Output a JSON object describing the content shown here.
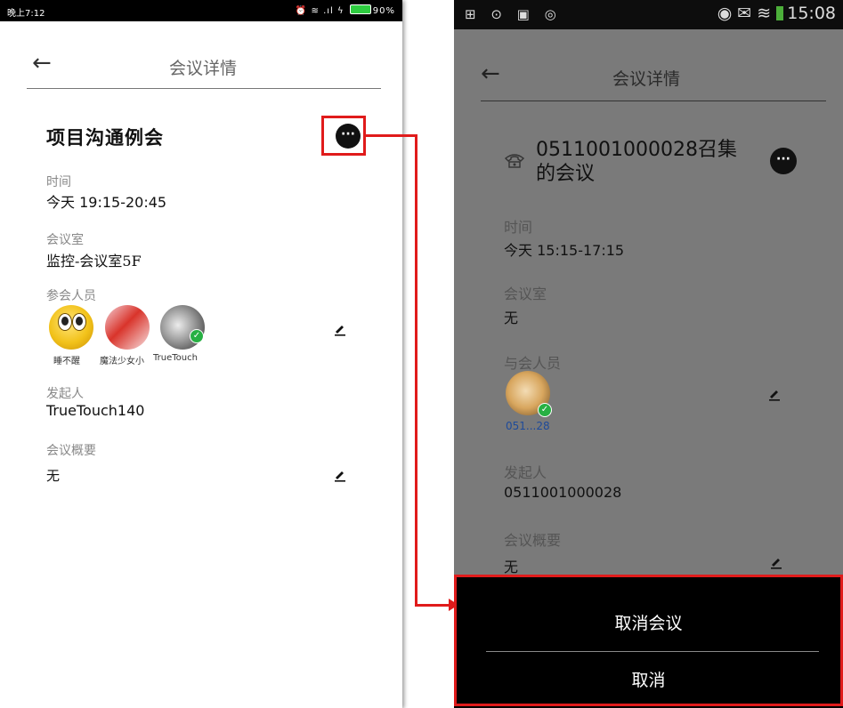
{
  "left": {
    "status_time": "晚上7:12",
    "status_icons": "⏰ ≋ .ıl ϟ",
    "battery": "90%",
    "title": "会议详情",
    "meeting_title": "项目沟通例会",
    "more_glyph": "···",
    "time_label": "时间",
    "time_value": "今天 19:15-20:45",
    "room_label": "会议室",
    "room_value": "监控-会议室5F",
    "attendees_label": "参会人员",
    "attendees": [
      "睡不醒",
      "魔法少女小",
      "TrueTouch"
    ],
    "organizer_label": "发起人",
    "organizer_value": "TrueTouch140",
    "summary_label": "会议概要",
    "summary_value": "无"
  },
  "right": {
    "status_left_icons": "⊞ ⊙ ▣ ◎",
    "status_right_icons": "◉ ✉ ≋",
    "status_time": "15:08",
    "title": "会议详情",
    "meeting_title": "0511001000028召集的会议",
    "more_glyph": "···",
    "time_label": "时间",
    "time_value": "今天 15:15-17:15",
    "room_label": "会议室",
    "room_value": "无",
    "attendees_label": "与会人员",
    "attendees": [
      "051...28"
    ],
    "organizer_label": "发起人",
    "organizer_value": "0511001000028",
    "summary_label": "会议概要",
    "summary_value": "无",
    "sheet": {
      "cancel_meeting": "取消会议",
      "cancel": "取消"
    }
  },
  "colors": {
    "highlight": "#e01b1b",
    "check_green": "#27b043"
  }
}
